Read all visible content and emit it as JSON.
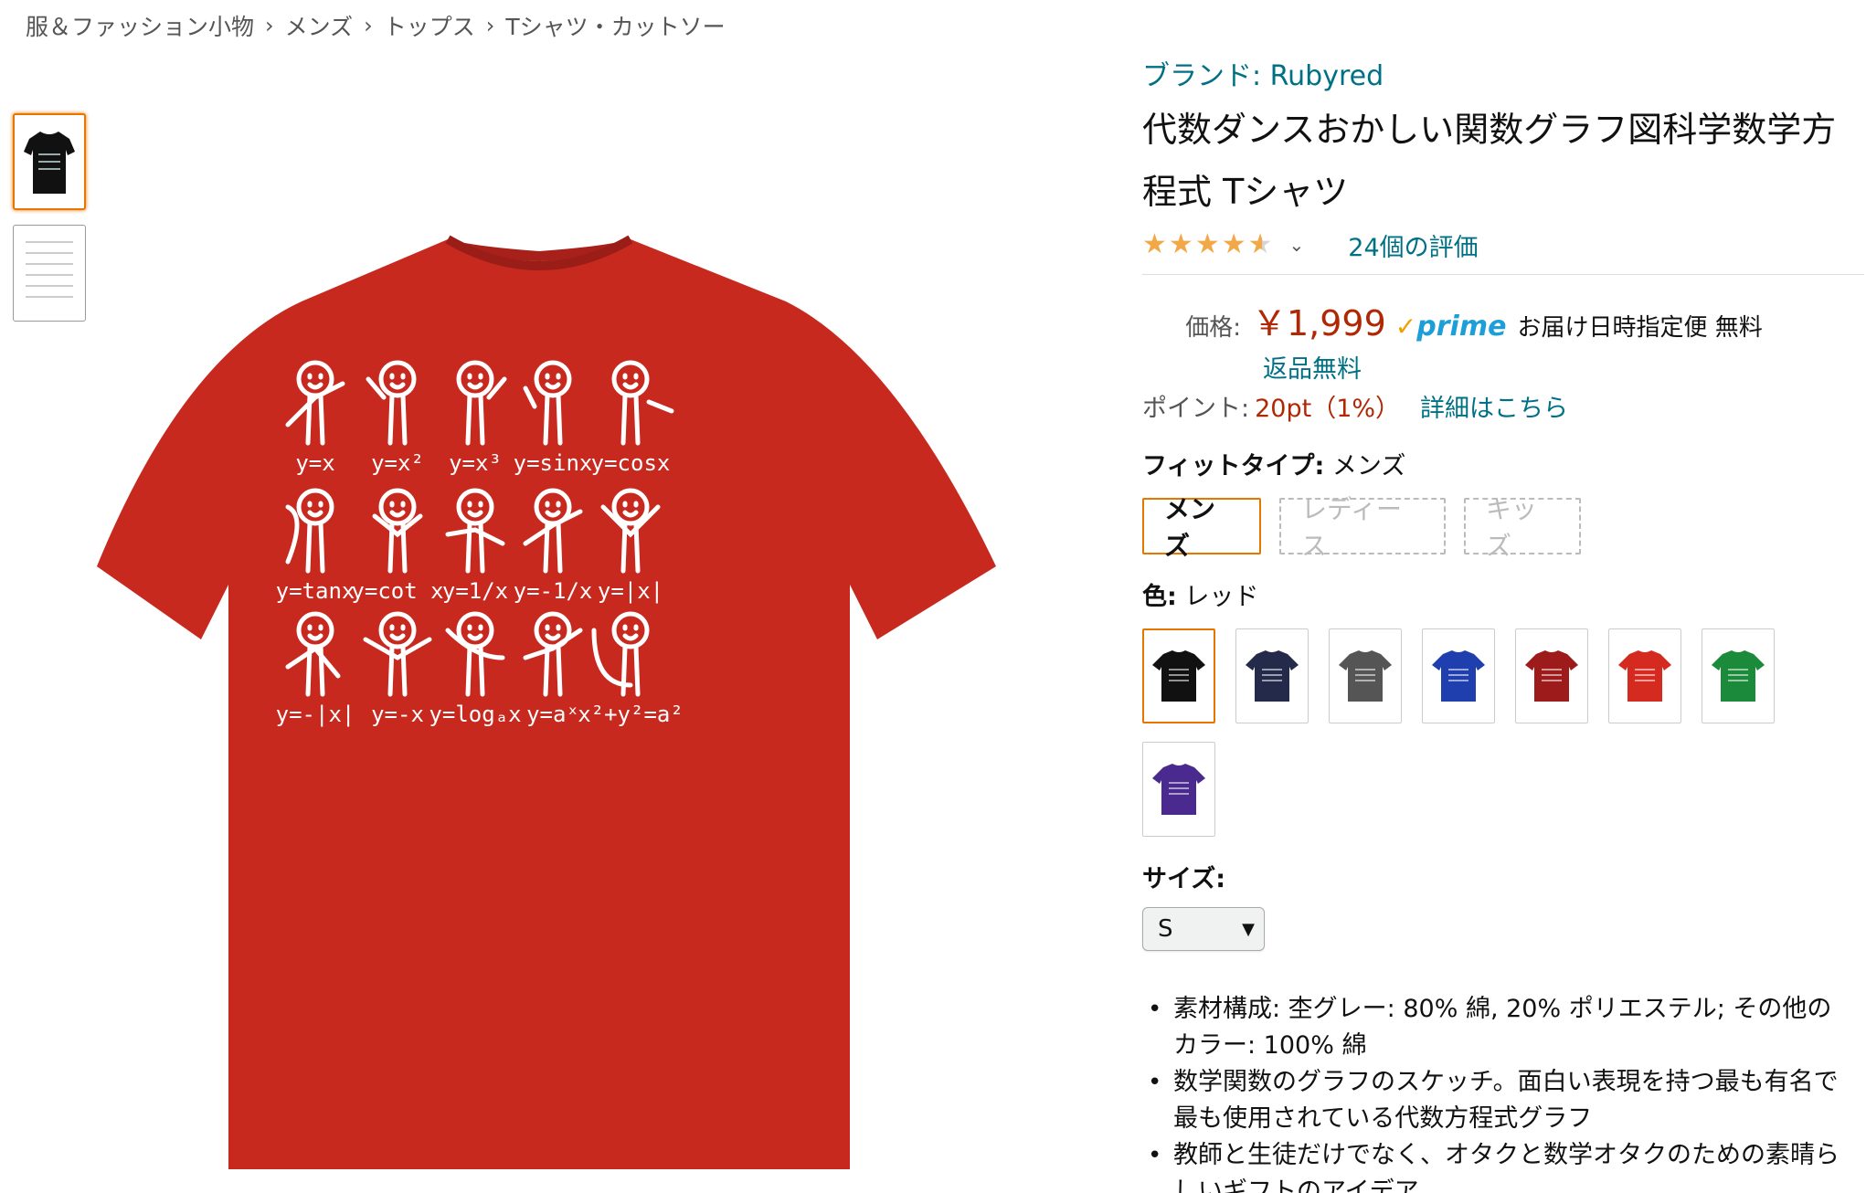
{
  "breadcrumb": [
    "服＆ファッション小物",
    "メンズ",
    "トップス",
    "Tシャツ・カットソー"
  ],
  "breadcrumb_separator": "›",
  "product": {
    "brand": "ブランド: Rubyred",
    "title": "代数ダンスおかしい関数グラフ図科学数学方程式 Tシャツ",
    "rating": 4.5,
    "review_count": "24個の評価",
    "price_label": "価格:",
    "price": "￥1,999",
    "prime_check": "✓",
    "prime_word": "prime",
    "delivery": "お届け日時指定便 無料",
    "return_free": "返品無料",
    "points_label": "ポイント:",
    "points_value": "20pt（1%）",
    "points_link": "詳細はこちら",
    "shirt_color": "#c8291f",
    "print_color": "#ffffff"
  },
  "fit": {
    "label": "フィットタイプ:",
    "value": "メンズ",
    "options": [
      {
        "label": "メンズ",
        "state": "selected"
      },
      {
        "label": "レディース",
        "state": "unavailable"
      },
      {
        "label": "キッズ",
        "state": "unavailable"
      }
    ]
  },
  "color": {
    "label": "色:",
    "value": "レッド",
    "swatches": [
      {
        "name": "black",
        "hex": "#111111",
        "selected": true
      },
      {
        "name": "navy",
        "hex": "#232a4a",
        "selected": false
      },
      {
        "name": "heather-gray",
        "hex": "#555555",
        "selected": false
      },
      {
        "name": "royal-blue",
        "hex": "#1f3fae",
        "selected": false
      },
      {
        "name": "cranberry",
        "hex": "#9e1b1b",
        "selected": false
      },
      {
        "name": "red",
        "hex": "#d42a1f",
        "selected": false
      },
      {
        "name": "kelly-green",
        "hex": "#1b8a3a",
        "selected": false
      },
      {
        "name": "purple",
        "hex": "#4b2a8f",
        "selected": false
      }
    ]
  },
  "size": {
    "label": "サイズ:",
    "selected": "S"
  },
  "bullets": [
    "素材構成: 杢グレー: 80% 綿, 20% ポリエステル; その他のカラー: 100% 綿",
    "数学関数のグラフのスケッチ。面白い表現を持つ最も有名で最も使用されている代数方程式グラフ",
    "教師と生徒だけでなく、オタクと数学オタクのための素晴らしいギフトのアイデア。"
  ],
  "shirt_print_labels": [
    [
      "y=x",
      "y=x²",
      "y=x³",
      "y=sinx",
      "y=cosx"
    ],
    [
      "y=tanx",
      "y=cot x",
      "y=1/x",
      "y=-1/x",
      "y=|x|"
    ],
    [
      "y=-|x|",
      "y=-x",
      "y=logₐx",
      "y=aˣ",
      "x²+y²=a²"
    ]
  ],
  "thumbnails": [
    {
      "name": "thumb-black-shirt",
      "selected": true
    },
    {
      "name": "thumb-detail",
      "selected": false
    }
  ]
}
